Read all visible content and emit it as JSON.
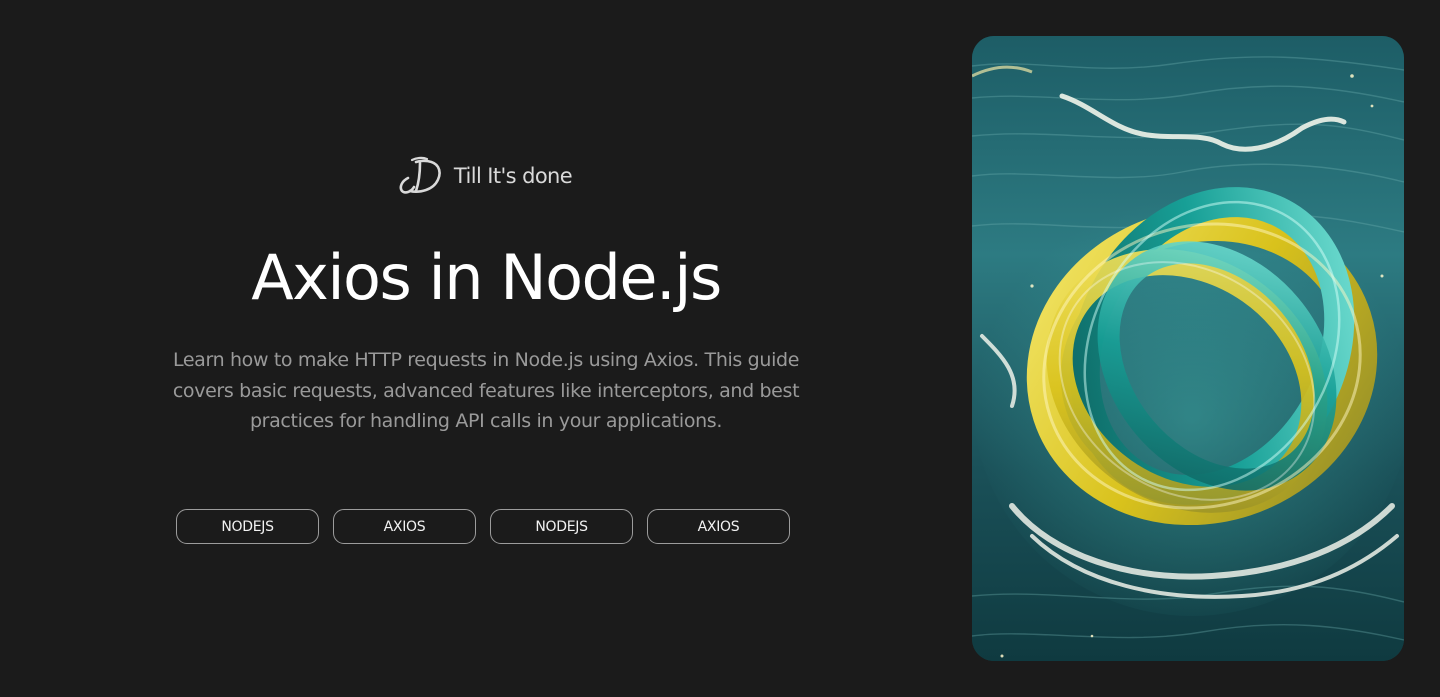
{
  "brand": {
    "logo_icon": "signature-d-logo-icon",
    "name": "Till It's done"
  },
  "hero": {
    "title": "Axios in Node.js",
    "description": "Learn how to make HTTP requests in Node.js using Axios. This guide covers basic requests, advanced features like interceptors, and best practices for handling API calls in your applications."
  },
  "tags": [
    {
      "label": "NODEJS"
    },
    {
      "label": "AXIOS"
    },
    {
      "label": "NODEJS"
    },
    {
      "label": "AXIOS"
    }
  ],
  "artwork": {
    "subject": "twisted-ribbon-knot-on-ocean-image",
    "colors": {
      "water_dark": "#0e3a42",
      "water_light": "#2f7f86",
      "foam": "#e9efe6",
      "ribbon_yellow": "#e8d431",
      "ribbon_teal": "#1fb2a6"
    }
  },
  "theme": {
    "background": "#1b1b1b",
    "text_primary": "#ffffff",
    "text_secondary": "#9a9a9a",
    "tag_border": "#9c9c9c"
  }
}
